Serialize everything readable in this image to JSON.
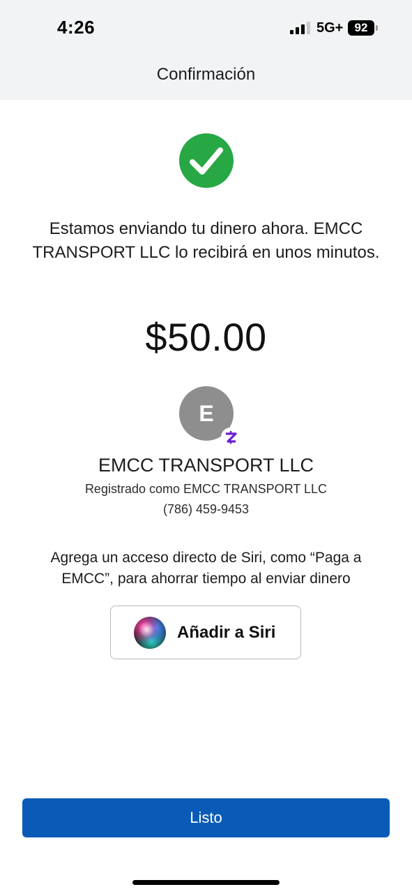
{
  "status_bar": {
    "time": "4:26",
    "network": "5G+",
    "battery": "92"
  },
  "nav": {
    "title": "Confirmación"
  },
  "confirmation": {
    "icon": "check-circle-icon",
    "message": "Estamos enviando tu dinero ahora. EMCC TRANSPORT LLC lo recibirá en unos minutos.",
    "amount": "$50.00"
  },
  "recipient": {
    "initial": "E",
    "name": "EMCC TRANSPORT LLC",
    "registered_as": "Registrado como EMCC TRANSPORT LLC",
    "phone": "(786) 459-9453"
  },
  "siri": {
    "prompt": "Agrega un acceso directo de Siri, como “Paga a EMCC”, para ahorrar tiempo al enviar dinero",
    "button_label": "Añadir a Siri"
  },
  "footer": {
    "done_label": "Listo"
  },
  "colors": {
    "header_bg": "#f2f3f5",
    "success_green": "#28a745",
    "primary_blue": "#0a5bb7",
    "zelle_purple": "#6d1ed4",
    "avatar_gray": "#8e8e8e"
  }
}
